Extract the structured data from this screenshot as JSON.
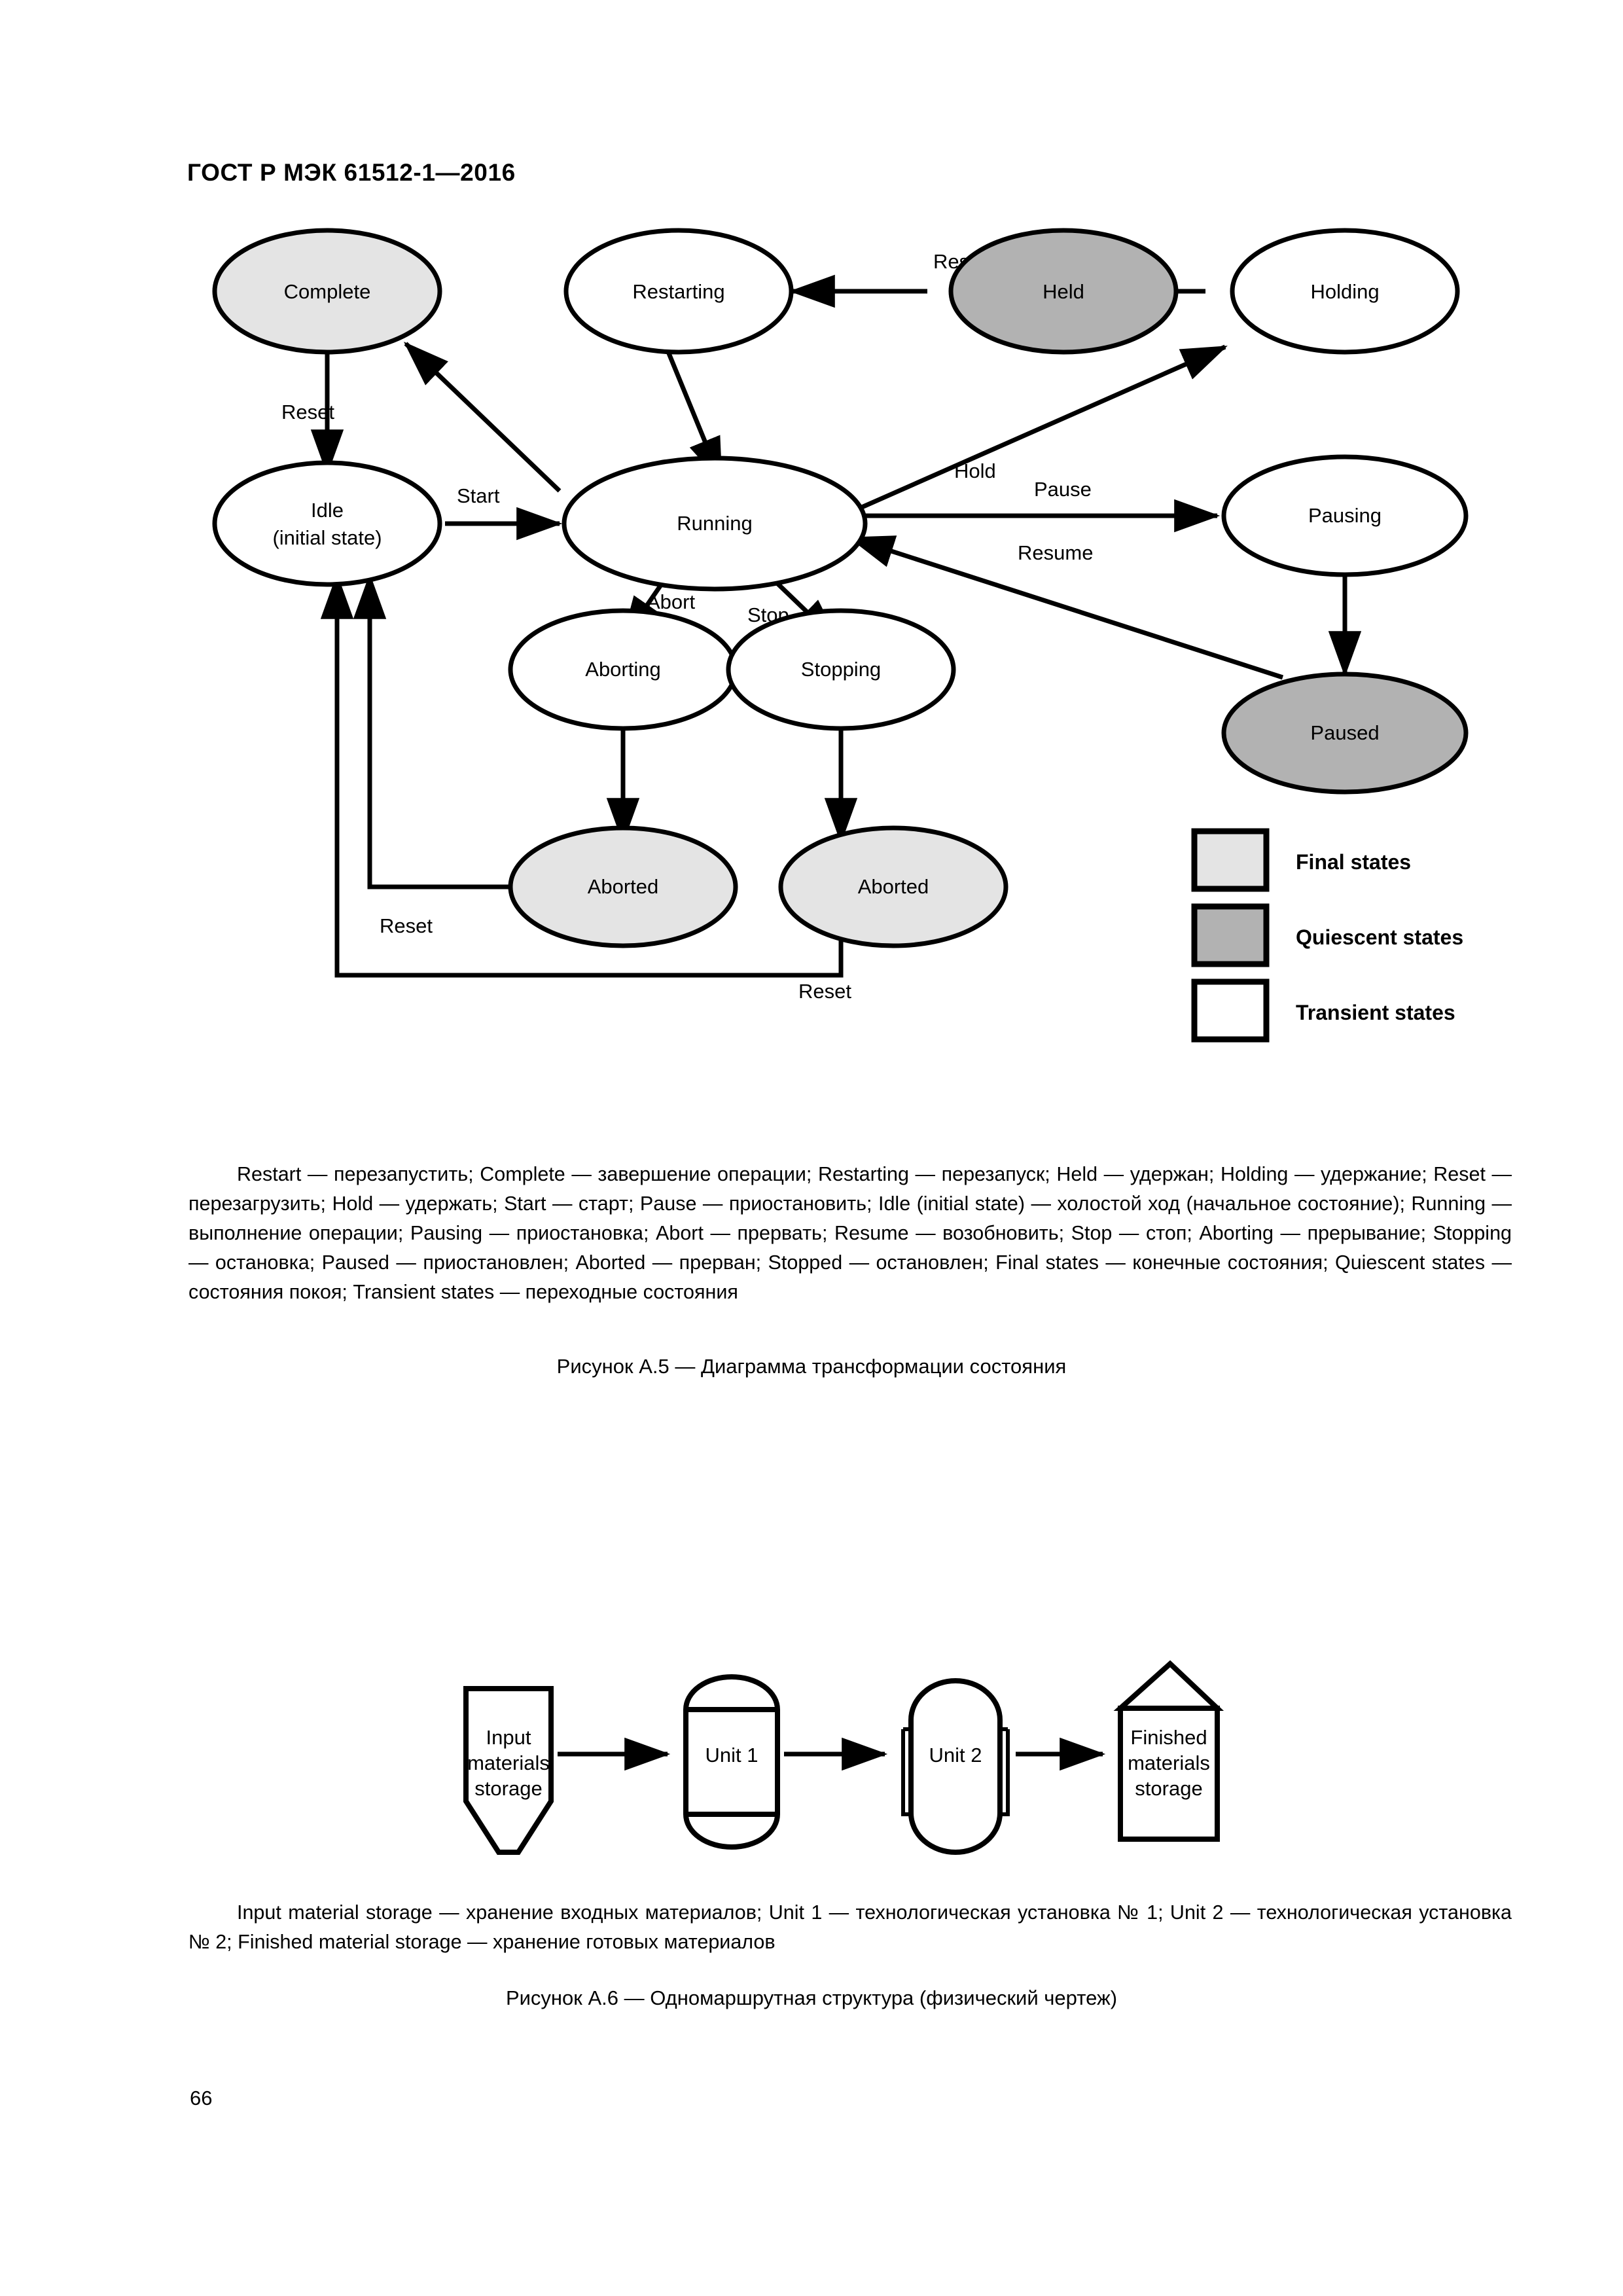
{
  "header": {
    "standard_title": "ГОСТ Р МЭК  61512-1—2016"
  },
  "page_number": "66",
  "figure_a5": {
    "caption": "Рисунок А.5 — Диаграмма трансформации состояния",
    "states": [
      {
        "id": "complete",
        "label": "Complete",
        "kind": "final"
      },
      {
        "id": "restarting",
        "label": "Restarting",
        "kind": "transient"
      },
      {
        "id": "held",
        "label": "Held",
        "kind": "quiescent"
      },
      {
        "id": "holding",
        "label": "Holding",
        "kind": "transient"
      },
      {
        "id": "idle",
        "label": "Idle",
        "label2": "(initial state)",
        "kind": "transient"
      },
      {
        "id": "running",
        "label": "Running",
        "kind": "transient"
      },
      {
        "id": "pausing",
        "label": "Pausing",
        "kind": "transient"
      },
      {
        "id": "paused",
        "label": "Paused",
        "kind": "quiescent"
      },
      {
        "id": "aborting",
        "label": "Aborting",
        "kind": "transient"
      },
      {
        "id": "stopping",
        "label": "Stopping",
        "kind": "transient"
      },
      {
        "id": "aborted1",
        "label": "Aborted",
        "kind": "final"
      },
      {
        "id": "aborted2",
        "label": "Aborted",
        "kind": "final"
      }
    ],
    "transitions": [
      {
        "id": "restart",
        "label": "Restart",
        "from": "held",
        "to": "restarting"
      },
      {
        "id": "holding",
        "label": "",
        "from": "holding",
        "to": "held"
      },
      {
        "id": "reset1",
        "label": "Reset",
        "from": "complete",
        "to": "idle"
      },
      {
        "id": "start",
        "label": "Start",
        "from": "idle",
        "to": "running"
      },
      {
        "id": "hold",
        "label": "Hold",
        "from": "running",
        "to": "holding"
      },
      {
        "id": "pause",
        "label": "Pause",
        "from": "running",
        "to": "pausing"
      },
      {
        "id": "resume",
        "label": "Resume",
        "from": "paused",
        "to": "running"
      },
      {
        "id": "abort",
        "label": "Abort",
        "from": "running",
        "to": "aborting"
      },
      {
        "id": "stop",
        "label": "Stop",
        "from": "running",
        "to": "stopping"
      },
      {
        "id": "reset2",
        "label": "Reset",
        "from": "aborted1",
        "to": "idle"
      },
      {
        "id": "reset3",
        "label": "Reset",
        "from": "aborted2",
        "to": "idle"
      }
    ],
    "legend": [
      {
        "id": "final",
        "label": "Final states",
        "color": "#e4e4e4"
      },
      {
        "id": "quiescent",
        "label": "Quiescent states",
        "color": "#b2b2b2"
      },
      {
        "id": "transient",
        "label": "Transient states",
        "color": "#ffffff"
      }
    ],
    "note_lines": [
      "Restart — перезапустить;  Complete — завершение операции;  Restarting — перезапуск;  Held — удержан; Holding — удержание; Reset — перезагрузить; Hold — удержать; Start — старт; Pause — приостановить; Idle (initial state) — холостой ход (начальное состояние);  Running — выполнение операции;  Pausing — приостановка; Abort — прервать;  Resume — возобновить;  Stop — стоп;  Aborting — прерывание;  Stopping — остановка; Paused — приостановлен;  Aborted — прерван;  Stopped — остановлен;  Final states — конечные состояния; Quiescent states — состояния покоя; Transient states — переходные состояния"
    ]
  },
  "figure_a6": {
    "caption": "Рисунок А.6 — Одномаршрутная структура (физический чертеж)",
    "nodes": [
      {
        "id": "input-storage",
        "label": "Input materials storage",
        "lines": [
          "Input",
          "materials",
          "storage"
        ],
        "shape": "hopper"
      },
      {
        "id": "unit-1",
        "label": "Unit 1",
        "lines": [
          "Unit 1"
        ],
        "shape": "vessel-v"
      },
      {
        "id": "unit-2",
        "label": "Unit 2",
        "lines": [
          "Unit 2"
        ],
        "shape": "vessel-j"
      },
      {
        "id": "finished-storage",
        "label": "Finished materials storage",
        "lines": [
          "Finished",
          "materials",
          "storage"
        ],
        "shape": "silo"
      }
    ],
    "flows": [
      {
        "from": "input-storage",
        "to": "unit-1"
      },
      {
        "from": "unit-1",
        "to": "unit-2"
      },
      {
        "from": "unit-2",
        "to": "finished-storage"
      }
    ],
    "note_lines": [
      "Input  material  storage  —  хранение  входных материалов; Unit 1 —  технологическая  установка № 1; Unit 2 — технологическая установка № 2; Finished material storage — хранение готовых материалов"
    ]
  }
}
